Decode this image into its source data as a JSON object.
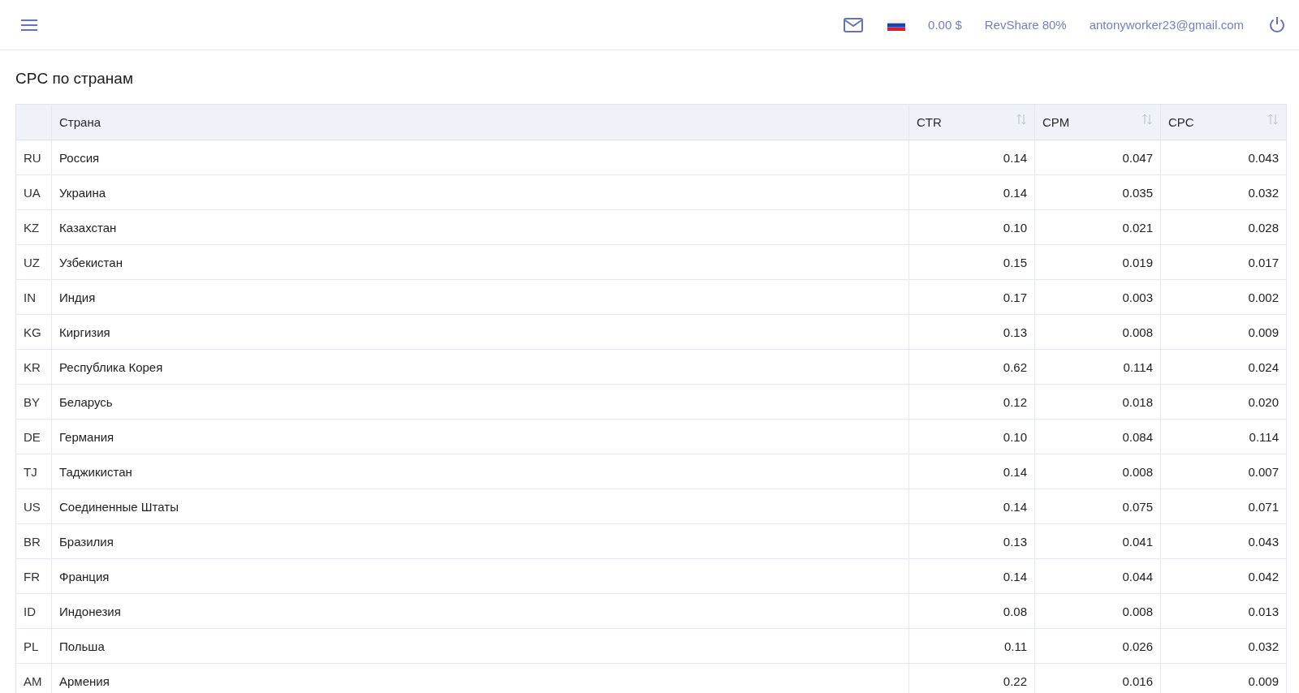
{
  "header": {
    "balance": "0.00 $",
    "revshare": "RevShare 80%",
    "email": "antonyworker23@gmail.com"
  },
  "title": "CPC по странам",
  "table": {
    "columns": [
      {
        "label": "Страна",
        "sortable": false
      },
      {
        "label": "CTR",
        "sortable": true
      },
      {
        "label": "CPM",
        "sortable": true
      },
      {
        "label": "CPC",
        "sortable": true
      }
    ],
    "rows": [
      {
        "code": "RU",
        "country": "Россия",
        "ctr": "0.14",
        "cpm": "0.047",
        "cpc": "0.043"
      },
      {
        "code": "UA",
        "country": "Украина",
        "ctr": "0.14",
        "cpm": "0.035",
        "cpc": "0.032"
      },
      {
        "code": "KZ",
        "country": "Казахстан",
        "ctr": "0.10",
        "cpm": "0.021",
        "cpc": "0.028"
      },
      {
        "code": "UZ",
        "country": "Узбекистан",
        "ctr": "0.15",
        "cpm": "0.019",
        "cpc": "0.017"
      },
      {
        "code": "IN",
        "country": "Индия",
        "ctr": "0.17",
        "cpm": "0.003",
        "cpc": "0.002"
      },
      {
        "code": "KG",
        "country": "Киргизия",
        "ctr": "0.13",
        "cpm": "0.008",
        "cpc": "0.009"
      },
      {
        "code": "KR",
        "country": "Республика Корея",
        "ctr": "0.62",
        "cpm": "0.114",
        "cpc": "0.024"
      },
      {
        "code": "BY",
        "country": "Беларусь",
        "ctr": "0.12",
        "cpm": "0.018",
        "cpc": "0.020"
      },
      {
        "code": "DE",
        "country": "Германия",
        "ctr": "0.10",
        "cpm": "0.084",
        "cpc": "0.114"
      },
      {
        "code": "TJ",
        "country": "Таджикистан",
        "ctr": "0.14",
        "cpm": "0.008",
        "cpc": "0.007"
      },
      {
        "code": "US",
        "country": "Соединенные Штаты",
        "ctr": "0.14",
        "cpm": "0.075",
        "cpc": "0.071"
      },
      {
        "code": "BR",
        "country": "Бразилия",
        "ctr": "0.13",
        "cpm": "0.041",
        "cpc": "0.043"
      },
      {
        "code": "FR",
        "country": "Франция",
        "ctr": "0.14",
        "cpm": "0.044",
        "cpc": "0.042"
      },
      {
        "code": "ID",
        "country": "Индонезия",
        "ctr": "0.08",
        "cpm": "0.008",
        "cpc": "0.013"
      },
      {
        "code": "PL",
        "country": "Польша",
        "ctr": "0.11",
        "cpm": "0.026",
        "cpc": "0.032"
      },
      {
        "code": "AM",
        "country": "Армения",
        "ctr": "0.22",
        "cpm": "0.016",
        "cpc": "0.009"
      }
    ]
  }
}
